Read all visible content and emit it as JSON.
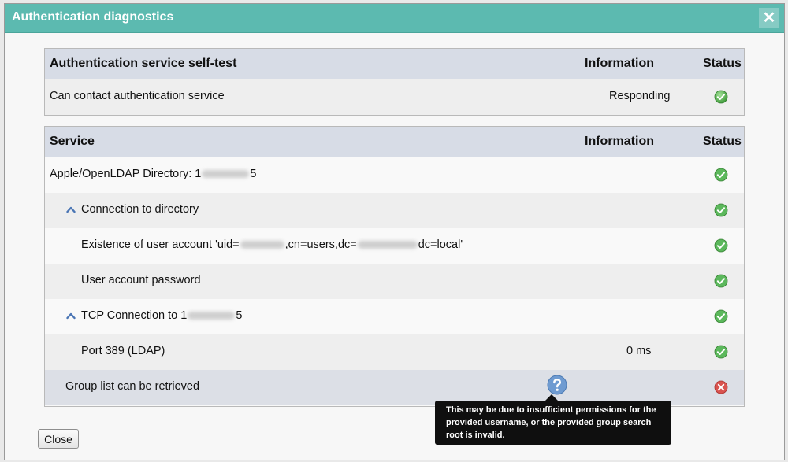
{
  "dialog": {
    "title": "Authentication diagnostics",
    "close_glyph": "✕"
  },
  "self_test": {
    "headers": {
      "name": "Authentication service self-test",
      "information": "Information",
      "status": "Status"
    },
    "rows": [
      {
        "label": "Can contact authentication service",
        "information": "Responding",
        "status": "ok"
      }
    ]
  },
  "services": {
    "headers": {
      "name": "Service",
      "information": "Information",
      "status": "Status"
    },
    "rows": [
      {
        "label_prefix": "Apple/OpenLDAP Directory: 1",
        "label_suffix": "5",
        "information": "",
        "status": "ok"
      },
      {
        "label": "Connection to directory",
        "information": "",
        "status": "ok"
      },
      {
        "label_prefix": "Existence of user account 'uid=",
        "label_mid": ",cn=users,dc=",
        "label_suffix": "dc=local'",
        "information": "",
        "status": "ok"
      },
      {
        "label": "User account password",
        "information": "",
        "status": "ok"
      },
      {
        "label_prefix": "TCP Connection to 1",
        "label_suffix": "5",
        "information": "",
        "status": "ok"
      },
      {
        "label": "Port 389 (LDAP)",
        "information": "0 ms",
        "status": "ok"
      },
      {
        "label": "Group list can be retrieved",
        "information": "",
        "status": "error"
      }
    ]
  },
  "tooltip": {
    "text": "This may be due to insufficient permissions for the provided username, or the provided group search root is invalid."
  },
  "footer": {
    "close_label": "Close"
  },
  "colors": {
    "titlebar": "#5cbab0",
    "header_row": "#d7dce6",
    "ok": "#5cb85c",
    "error": "#d9534f",
    "help": "#6f9bd1"
  },
  "icons": {
    "ok": "check-circle-icon",
    "error": "x-circle-icon",
    "help": "question-circle-icon",
    "expand": "chevron-up-icon"
  }
}
